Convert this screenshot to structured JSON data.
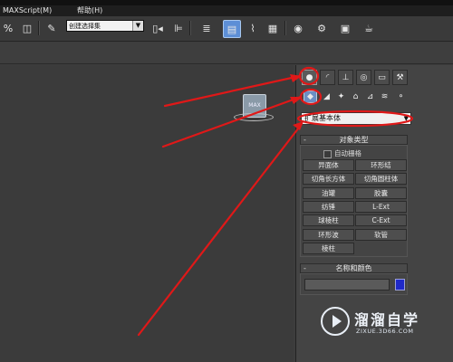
{
  "menubar": {
    "items": [
      "MAXScript(M)",
      "帮助(H)"
    ]
  },
  "toolbar": {
    "selection_set": "创建选择集",
    "icons": [
      "percent-snap-icon",
      "spinner-snap-icon",
      "edit-named-sets-icon",
      "mirror-icon",
      "align-icon",
      "layer-manager-icon",
      "scene-explorer-icon",
      "curve-editor-icon",
      "schematic-view-icon",
      "material-editor-icon",
      "render-setup-icon",
      "rendered-frame-icon",
      "render-teapot-icon"
    ]
  },
  "command_panel": {
    "tabs": [
      "create-tab",
      "modify-tab",
      "hierarchy-tab",
      "motion-tab",
      "display-tab",
      "utilities-tab"
    ],
    "subtabs": [
      "geometry",
      "shapes",
      "lights",
      "cameras",
      "helpers",
      "space-warps",
      "systems"
    ],
    "category": "扩展基本体",
    "object_type": {
      "title": "对象类型",
      "autogrid": "自动栅格",
      "buttons": [
        "异面体",
        "环形结",
        "切角长方体",
        "切角圆柱体",
        "油罐",
        "胶囊",
        "纺锤",
        "L-Ext",
        "球棱柱",
        "C-Ext",
        "环形波",
        "软管",
        "棱柱"
      ]
    },
    "name_color": {
      "title": "名称和颜色",
      "name_value": "",
      "color": "#1f29c8"
    }
  },
  "annotation": {
    "color": "#e01818"
  },
  "watermark": {
    "title": "溜溜自学",
    "url": "ZIXUE.3D66.COM"
  },
  "colors": {
    "background": "#3d3d3d",
    "accent": "#5d8fd6"
  }
}
